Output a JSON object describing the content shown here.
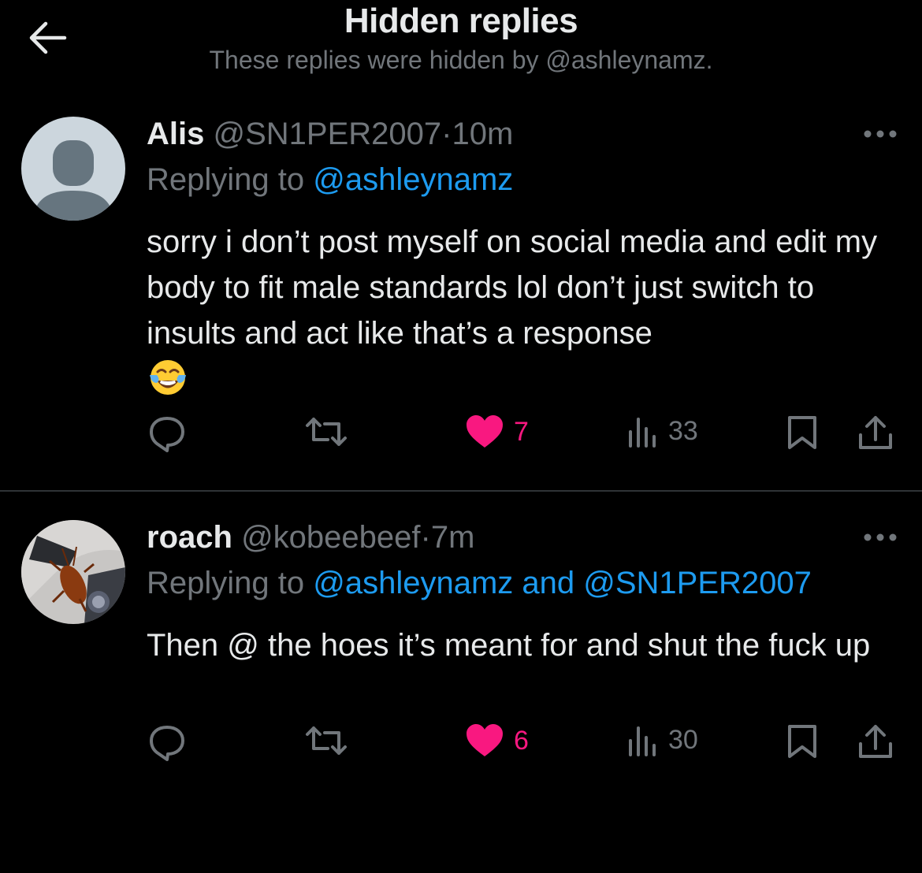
{
  "header": {
    "title": "Hidden replies",
    "subtitle": "These replies were hidden by @ashleynamz."
  },
  "tweets": [
    {
      "display_name": "Alis",
      "handle": "@SN1PER2007",
      "separator": "·",
      "time": "10m",
      "replying_prefix": "Replying to ",
      "replying_to": [
        "@ashleynamz"
      ],
      "replying_joiner": "",
      "text": "sorry i don’t post myself on social media and edit my body to fit male standards lol don’t just switch to insults and act like that’s a response",
      "emoji": "face-with-tears-of-joy",
      "likes": "7",
      "views": "33",
      "liked": true
    },
    {
      "display_name": "roach",
      "handle": "@kobeebeef",
      "separator": "·",
      "time": "7m",
      "replying_prefix": "Replying to ",
      "replying_to": [
        "@ashleynamz",
        "@SN1PER2007"
      ],
      "replying_joiner": " and ",
      "text": "Then @ the hoes it’s meant for and shut the fuck up",
      "likes": "6",
      "views": "30",
      "liked": true
    }
  ],
  "icons": {
    "back": "arrow-left-icon",
    "more": "more-horizontal-icon",
    "reply": "reply-icon",
    "retweet": "retweet-icon",
    "like": "heart-icon",
    "views": "views-icon",
    "bookmark": "bookmark-icon",
    "share": "share-icon"
  },
  "colors": {
    "background": "#000000",
    "text": "#e7e9ea",
    "muted": "#71767b",
    "link": "#1d9bf0",
    "like": "#f91880",
    "divider": "#2f3336"
  }
}
